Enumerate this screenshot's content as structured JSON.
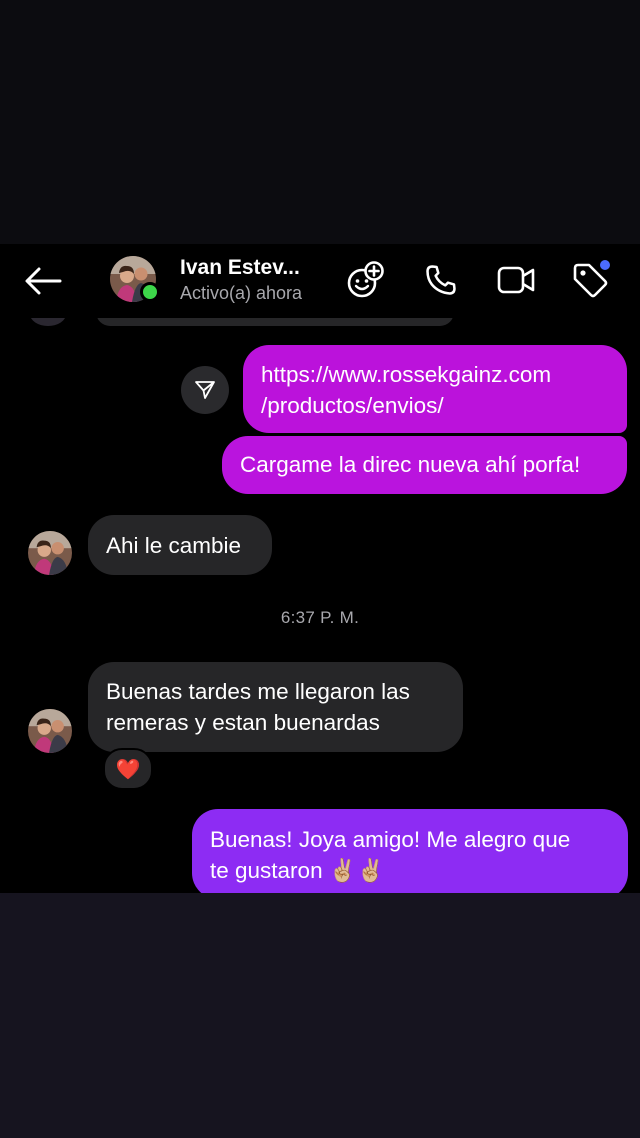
{
  "header": {
    "contact_name": "Ivan Estev...",
    "status": "Activo(a) ahora"
  },
  "icons": {
    "back": "arrow-left-icon",
    "sticker": "sticker-add-icon",
    "call": "phone-icon",
    "video": "video-camera-icon",
    "tag": "tag-icon",
    "share": "paper-plane-icon"
  },
  "colors": {
    "outgoing_magenta": "#bb12db",
    "outgoing_violet": "#8d2cf3",
    "incoming": "#262628",
    "online": "#3dd64a",
    "badge": "#4b6bff"
  },
  "messages": {
    "link_line1": "https://www.rossekgainz.com",
    "link_line2": "/productos/envios/",
    "out_2": "Cargame la direc nueva ahí porfa!",
    "in_1": "Ahi le cambie",
    "timestamp": "6:37 P. M.",
    "in_2_line1": "Buenas tardes me llegaron las",
    "in_2_line2": "remeras y estan buenardas",
    "reaction": "❤️",
    "out_3_line1": "Buenas! Joya amigo! Me alegro que",
    "out_3_line2": "te gustaron ✌🏼✌🏼"
  }
}
